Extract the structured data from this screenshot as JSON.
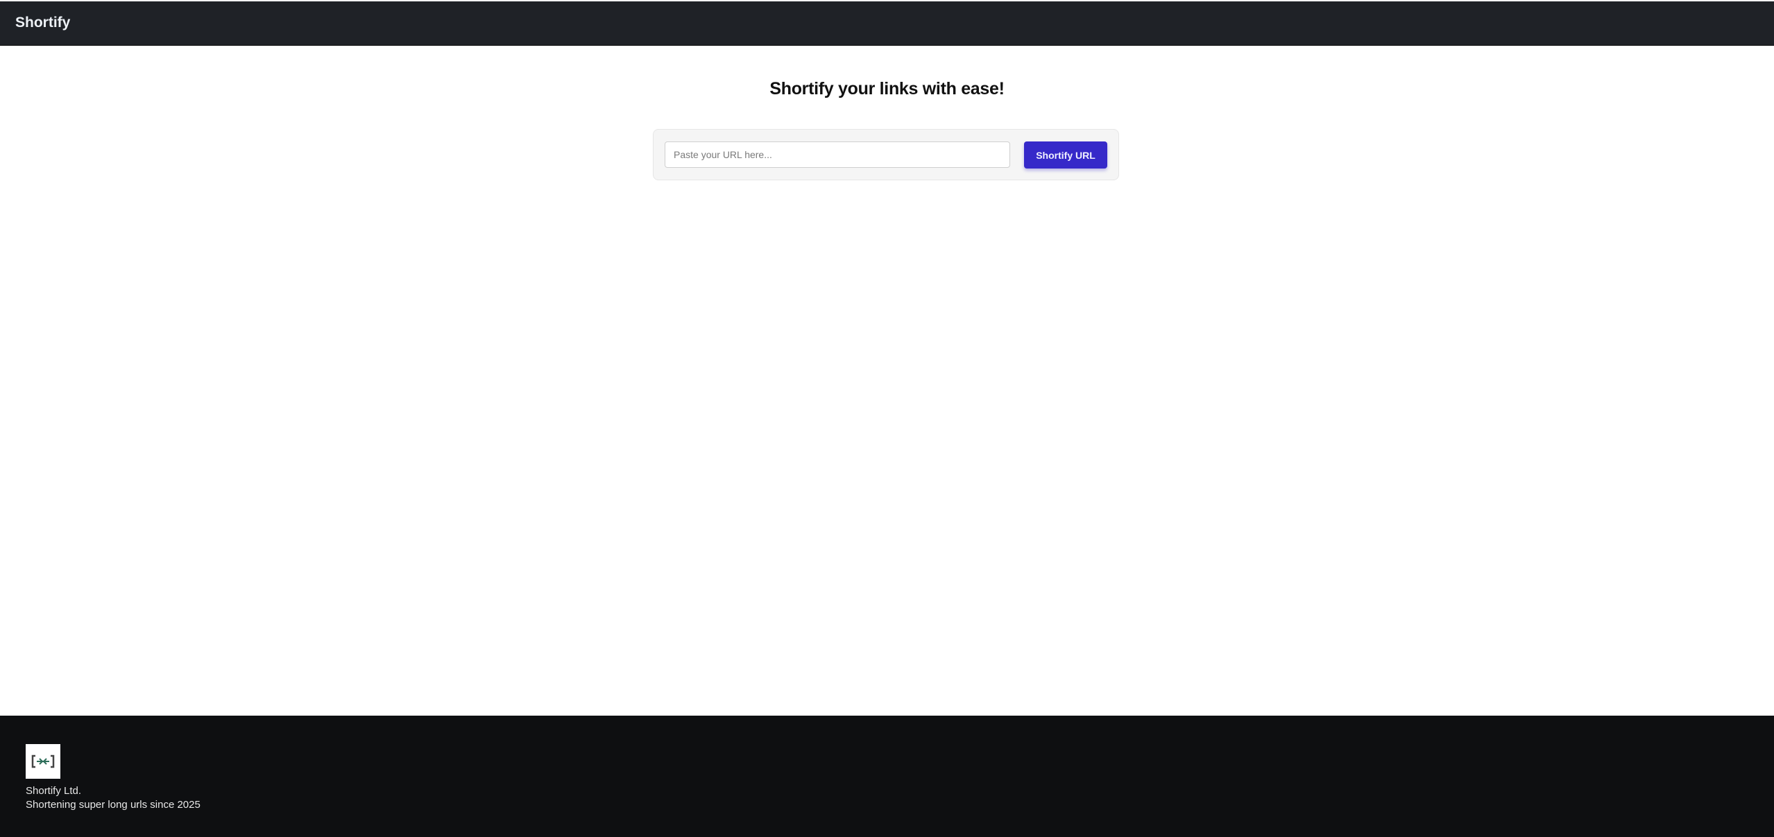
{
  "navbar": {
    "brand": "Shortify"
  },
  "main": {
    "title": "Shortify your links with ease!",
    "url_input": {
      "placeholder": "Paste your URL here...",
      "value": ""
    },
    "submit_label": "Shortify URL"
  },
  "footer": {
    "company": "Shortify Ltd.",
    "tagline": "Shortening super long urls since 2025"
  },
  "colors": {
    "accent": "#3629c9",
    "navbar": "#1f2227",
    "footer": "#0e0f11",
    "logo_green": "#2e6e5a"
  }
}
